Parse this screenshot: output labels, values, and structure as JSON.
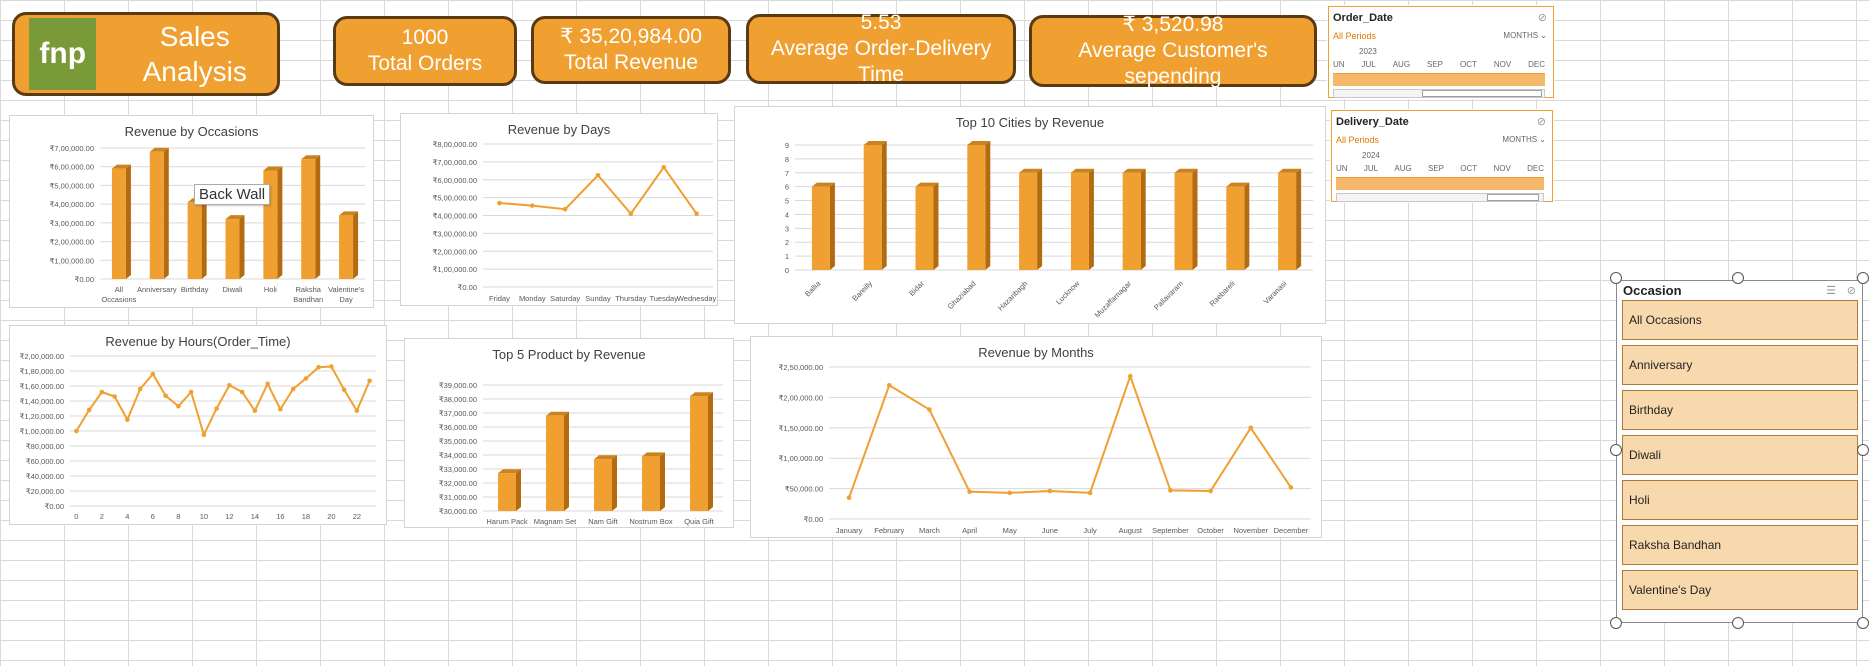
{
  "brand": {
    "logo_text": "fnp",
    "title": "Sales Analysis"
  },
  "kpis": [
    {
      "value": "1000",
      "label": "Total Orders"
    },
    {
      "value": "₹ 35,20,984.00",
      "label": "Total Revenue"
    },
    {
      "value": "5.53",
      "label": "Average Order-Delivery Time"
    },
    {
      "value": "₹ 3,520.98",
      "label": "Average Customer's sepending"
    }
  ],
  "colors": {
    "accent": "#f0a030",
    "accent_dark": "#b36b12",
    "kpi_border": "#5a3a12",
    "slicer_item": "#f8d9ad"
  },
  "tooltip": "Back Wall",
  "slicers": {
    "order_date": {
      "title": "Order_Date",
      "periods": "All Periods",
      "granularity": "MONTHS ⌄",
      "year": "2023",
      "months": [
        "UN",
        "JUL",
        "AUG",
        "SEP",
        "OCT",
        "NOV",
        "DEC"
      ]
    },
    "delivery_date": {
      "title": "Delivery_Date",
      "periods": "All Periods",
      "granularity": "MONTHS ⌄",
      "year": "2024",
      "months": [
        "UN",
        "JUL",
        "AUG",
        "SEP",
        "OCT",
        "NOV",
        "DEC"
      ]
    },
    "occasion": {
      "title": "Occasion",
      "items": [
        "All Occasions",
        "Anniversary",
        "Birthday",
        "Diwali",
        "Holi",
        "Raksha Bandhan",
        "Valentine's Day"
      ]
    }
  },
  "chart_data": [
    {
      "id": "occasions",
      "type": "bar",
      "title": "Revenue by Occasions",
      "categories": [
        "All Occasions",
        "Anniversary",
        "Birthday",
        "Diwali",
        "Holi",
        "Raksha Bandhan",
        "Valentine's Day"
      ],
      "category_labels": [
        [
          "All",
          "Occasions"
        ],
        [
          "Anniversary"
        ],
        [
          "Birthday"
        ],
        [
          "Diwali"
        ],
        [
          "Holi"
        ],
        [
          "Raksha",
          "Bandhan"
        ],
        [
          "Valentine's",
          "Day"
        ]
      ],
      "values": [
        590000,
        680000,
        410000,
        320000,
        580000,
        640000,
        340000
      ],
      "ylim": [
        0,
        700000
      ],
      "yticks": [
        "₹0.00",
        "₹1,00,000.00",
        "₹2,00,000.00",
        "₹3,00,000.00",
        "₹4,00,000.00",
        "₹5,00,000.00",
        "₹6,00,000.00",
        "₹7,00,000.00"
      ]
    },
    {
      "id": "days",
      "type": "line",
      "title": "Revenue by Days",
      "categories": [
        "Friday",
        "Monday",
        "Saturday",
        "Sunday",
        "Thursday",
        "Tuesday",
        "Wednesday"
      ],
      "values": [
        470000,
        455000,
        435000,
        625000,
        410000,
        670000,
        410000
      ],
      "ylim": [
        0,
        800000
      ],
      "yticks": [
        "₹0.00",
        "₹1,00,000.00",
        "₹2,00,000.00",
        "₹3,00,000.00",
        "₹4,00,000.00",
        "₹5,00,000.00",
        "₹6,00,000.00",
        "₹7,00,000.00",
        "₹8,00,000.00"
      ]
    },
    {
      "id": "cities",
      "type": "bar",
      "title": "Top 10 Cities by Revenue",
      "categories": [
        "Ballia",
        "Bareilly",
        "Bidar",
        "Ghaziabad",
        "Hazaribagh",
        "Lucknow",
        "Muzaffarnagar",
        "Pallavaram",
        "Raebareli",
        "Varanasi"
      ],
      "values": [
        6,
        9,
        6,
        9,
        7,
        7,
        7,
        7,
        6,
        7
      ],
      "ylim": [
        0,
        9
      ],
      "yticks": [
        "0",
        "1",
        "2",
        "3",
        "4",
        "5",
        "6",
        "7",
        "8",
        "9"
      ]
    },
    {
      "id": "hours",
      "type": "line",
      "title": "Revenue by Hours(Order_Time)",
      "x": [
        0,
        1,
        2,
        3,
        4,
        5,
        6,
        7,
        8,
        9,
        10,
        11,
        12,
        13,
        14,
        15,
        16,
        17,
        18,
        19,
        20,
        21,
        22,
        23
      ],
      "xticks": [
        "0",
        "2",
        "4",
        "6",
        "8",
        "10",
        "12",
        "14",
        "16",
        "18",
        "20",
        "22"
      ],
      "values": [
        100000,
        128000,
        152000,
        146000,
        115000,
        156000,
        176000,
        147000,
        133000,
        152000,
        95000,
        130000,
        161000,
        152000,
        127000,
        163000,
        129000,
        156000,
        170000,
        185000,
        186000,
        155000,
        127000,
        167000
      ],
      "ylim": [
        0,
        200000
      ],
      "yticks": [
        "₹0.00",
        "₹20,000.00",
        "₹40,000.00",
        "₹60,000.00",
        "₹80,000.00",
        "₹1,00,000.00",
        "₹1,20,000.00",
        "₹1,40,000.00",
        "₹1,60,000.00",
        "₹1,80,000.00",
        "₹2,00,000.00"
      ]
    },
    {
      "id": "products",
      "type": "bar",
      "title": "Top 5 Product by Revenue",
      "categories": [
        "Harum Pack",
        "Magnam Set",
        "Nam Gift",
        "Nostrum Box",
        "Quia Gift"
      ],
      "values": [
        32700,
        36800,
        33700,
        33900,
        38200
      ],
      "ylim": [
        30000,
        39000
      ],
      "yticks": [
        "₹30,000.00",
        "₹31,000.00",
        "₹32,000.00",
        "₹33,000.00",
        "₹34,000.00",
        "₹35,000.00",
        "₹36,000.00",
        "₹37,000.00",
        "₹38,000.00",
        "₹39,000.00"
      ]
    },
    {
      "id": "months",
      "type": "line",
      "title": "Revenue by Months",
      "categories": [
        "January",
        "February",
        "March",
        "April",
        "May",
        "June",
        "July",
        "August",
        "September",
        "October",
        "November",
        "December"
      ],
      "values": [
        35000,
        220000,
        180000,
        45000,
        43000,
        46000,
        43000,
        235000,
        47000,
        46000,
        150000,
        52000
      ],
      "ylim": [
        0,
        250000
      ],
      "yticks": [
        "₹0.00",
        "₹50,000.00",
        "₹1,00,000.00",
        "₹1,50,000.00",
        "₹2,00,000.00",
        "₹2,50,000.00"
      ]
    }
  ]
}
